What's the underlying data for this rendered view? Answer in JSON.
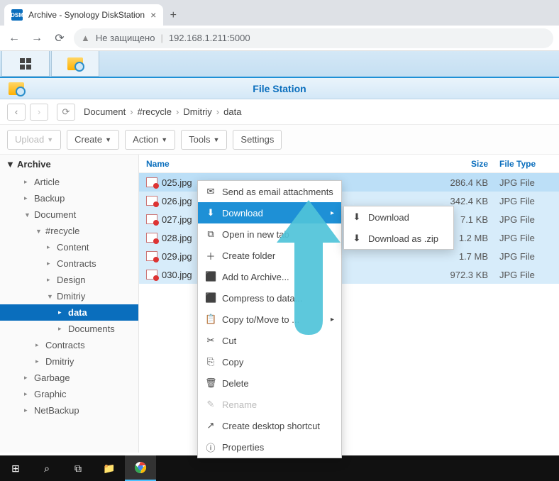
{
  "browser": {
    "tab_title": "Archive - Synology DiskStation",
    "favicon_text": "DSM",
    "security_text": "Не защищено",
    "address": "192.168.1.211:5000"
  },
  "filestation": {
    "title": "File Station",
    "breadcrumb": [
      "Document",
      "#recycle",
      "Dmitriy",
      "data"
    ],
    "buttons": {
      "upload": "Upload",
      "create": "Create",
      "action": "Action",
      "tools": "Tools",
      "settings": "Settings"
    },
    "columns": {
      "name": "Name",
      "size": "Size",
      "type": "File Type"
    },
    "sidebar": {
      "root": "Archive",
      "items": [
        {
          "label": "Article",
          "depth": 1,
          "expanded": false
        },
        {
          "label": "Backup",
          "depth": 1,
          "expanded": false
        },
        {
          "label": "Document",
          "depth": 1,
          "expanded": true
        },
        {
          "label": "#recycle",
          "depth": 2,
          "expanded": true
        },
        {
          "label": "Content",
          "depth": 3,
          "expanded": false
        },
        {
          "label": "Contracts",
          "depth": 3,
          "expanded": false
        },
        {
          "label": "Design",
          "depth": 3,
          "expanded": false
        },
        {
          "label": "Dmitriy",
          "depth": 3,
          "expanded": true
        },
        {
          "label": "data",
          "depth": 4,
          "expanded": false,
          "active": true
        },
        {
          "label": "Documents",
          "depth": 4,
          "expanded": false
        },
        {
          "label": "Contracts",
          "depth": 2,
          "expanded": false
        },
        {
          "label": "Dmitriy",
          "depth": 2,
          "expanded": false
        },
        {
          "label": "Garbage",
          "depth": 1,
          "expanded": false
        },
        {
          "label": "Graphic",
          "depth": 1,
          "expanded": false
        },
        {
          "label": "NetBackup",
          "depth": 1,
          "expanded": false
        }
      ]
    },
    "files": [
      {
        "name": "025.jpg",
        "size": "286.4 KB",
        "type": "JPG File"
      },
      {
        "name": "026.jpg",
        "size": "342.4 KB",
        "type": "JPG File"
      },
      {
        "name": "027.jpg",
        "size": "7.1 KB",
        "type": "JPG File"
      },
      {
        "name": "028.jpg",
        "size": "1.2 MB",
        "type": "JPG File"
      },
      {
        "name": "029.jpg",
        "size": "1.7 MB",
        "type": "JPG File"
      },
      {
        "name": "030.jpg",
        "size": "972.3 KB",
        "type": "JPG File"
      }
    ]
  },
  "contextmenu": {
    "items": [
      {
        "icon": "✉",
        "label": "Send as email attachments"
      },
      {
        "icon": "⬇",
        "label": "Download",
        "highlight": true,
        "submenu": true
      },
      {
        "icon": "⧉",
        "label": "Open in new tab"
      },
      {
        "icon": "＋",
        "label": "Create folder"
      },
      {
        "icon": "⬛",
        "label": "Add to Archive..."
      },
      {
        "icon": "⬛",
        "label": "Compress to data..."
      },
      {
        "icon": "📋",
        "label": "Copy to/Move to ...",
        "submenu": true
      },
      {
        "icon": "✂",
        "label": "Cut"
      },
      {
        "icon": "⎘",
        "label": "Copy"
      },
      {
        "icon": "🗑",
        "label": "Delete"
      },
      {
        "icon": "✎",
        "label": "Rename",
        "disabled": true
      },
      {
        "icon": "↗",
        "label": "Create desktop shortcut"
      },
      {
        "icon": "ⓘ",
        "label": "Properties"
      }
    ],
    "submenu": [
      {
        "icon": "⬇",
        "label": "Download"
      },
      {
        "icon": "⬇",
        "label": "Download as .zip"
      }
    ]
  },
  "arrow_color": "#4fc3d9"
}
